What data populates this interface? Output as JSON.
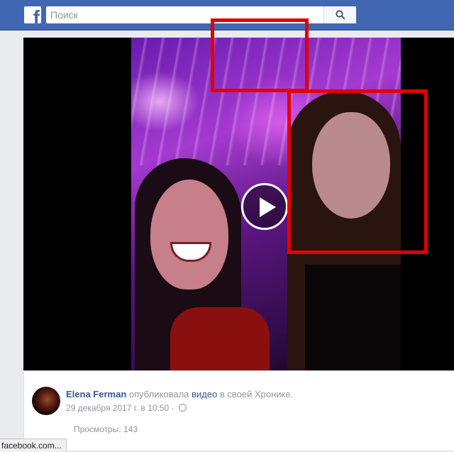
{
  "header": {
    "logo_letter": "f",
    "search_placeholder": "Поиск"
  },
  "post": {
    "author": "Elena Ferman",
    "action_text": "опубликовала",
    "object_link": "видео",
    "location_text": "в своей Хронике.",
    "timestamp": "29 декабря 2017 г. в 10:50",
    "privacy_separator": "·",
    "views": "Просмотры: 143"
  },
  "statusbar": {
    "url": "facebook.com..."
  },
  "colors": {
    "brand": "#4267b2",
    "highlight": "#e40000"
  }
}
